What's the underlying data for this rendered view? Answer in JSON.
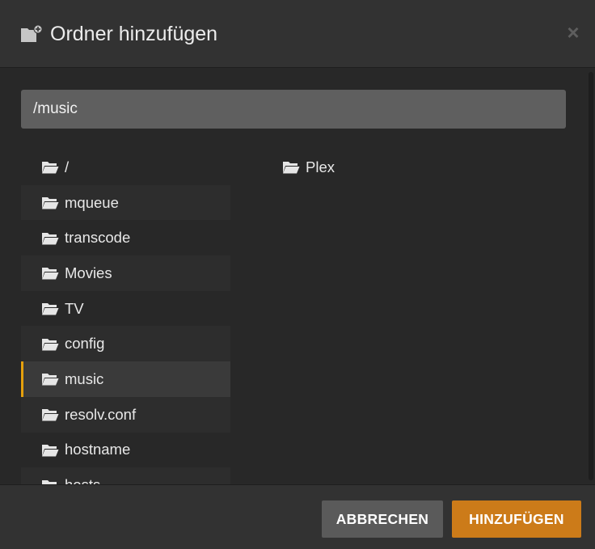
{
  "dialog": {
    "title": "Ordner hinzufügen",
    "close_glyph": "×",
    "header_icon": "folder-add-icon"
  },
  "path_input": {
    "value": "/music"
  },
  "browser": {
    "folder_icon": "folder-icon",
    "selected_index": 6,
    "column1": [
      {
        "label": "/"
      },
      {
        "label": "mqueue"
      },
      {
        "label": "transcode"
      },
      {
        "label": "Movies"
      },
      {
        "label": "TV"
      },
      {
        "label": "config"
      },
      {
        "label": "music"
      },
      {
        "label": "resolv.conf"
      },
      {
        "label": "hostname"
      },
      {
        "label": "hosts"
      }
    ],
    "column2": [
      {
        "label": "Plex"
      }
    ]
  },
  "footer": {
    "cancel_label": "ABBRECHEN",
    "add_label": "HINZUFÜGEN"
  },
  "colors": {
    "accent": "#e5a00d",
    "primary_button": "#cc7b19",
    "secondary_button": "#5a5a5a",
    "background": "#282828",
    "header": "#323232"
  }
}
